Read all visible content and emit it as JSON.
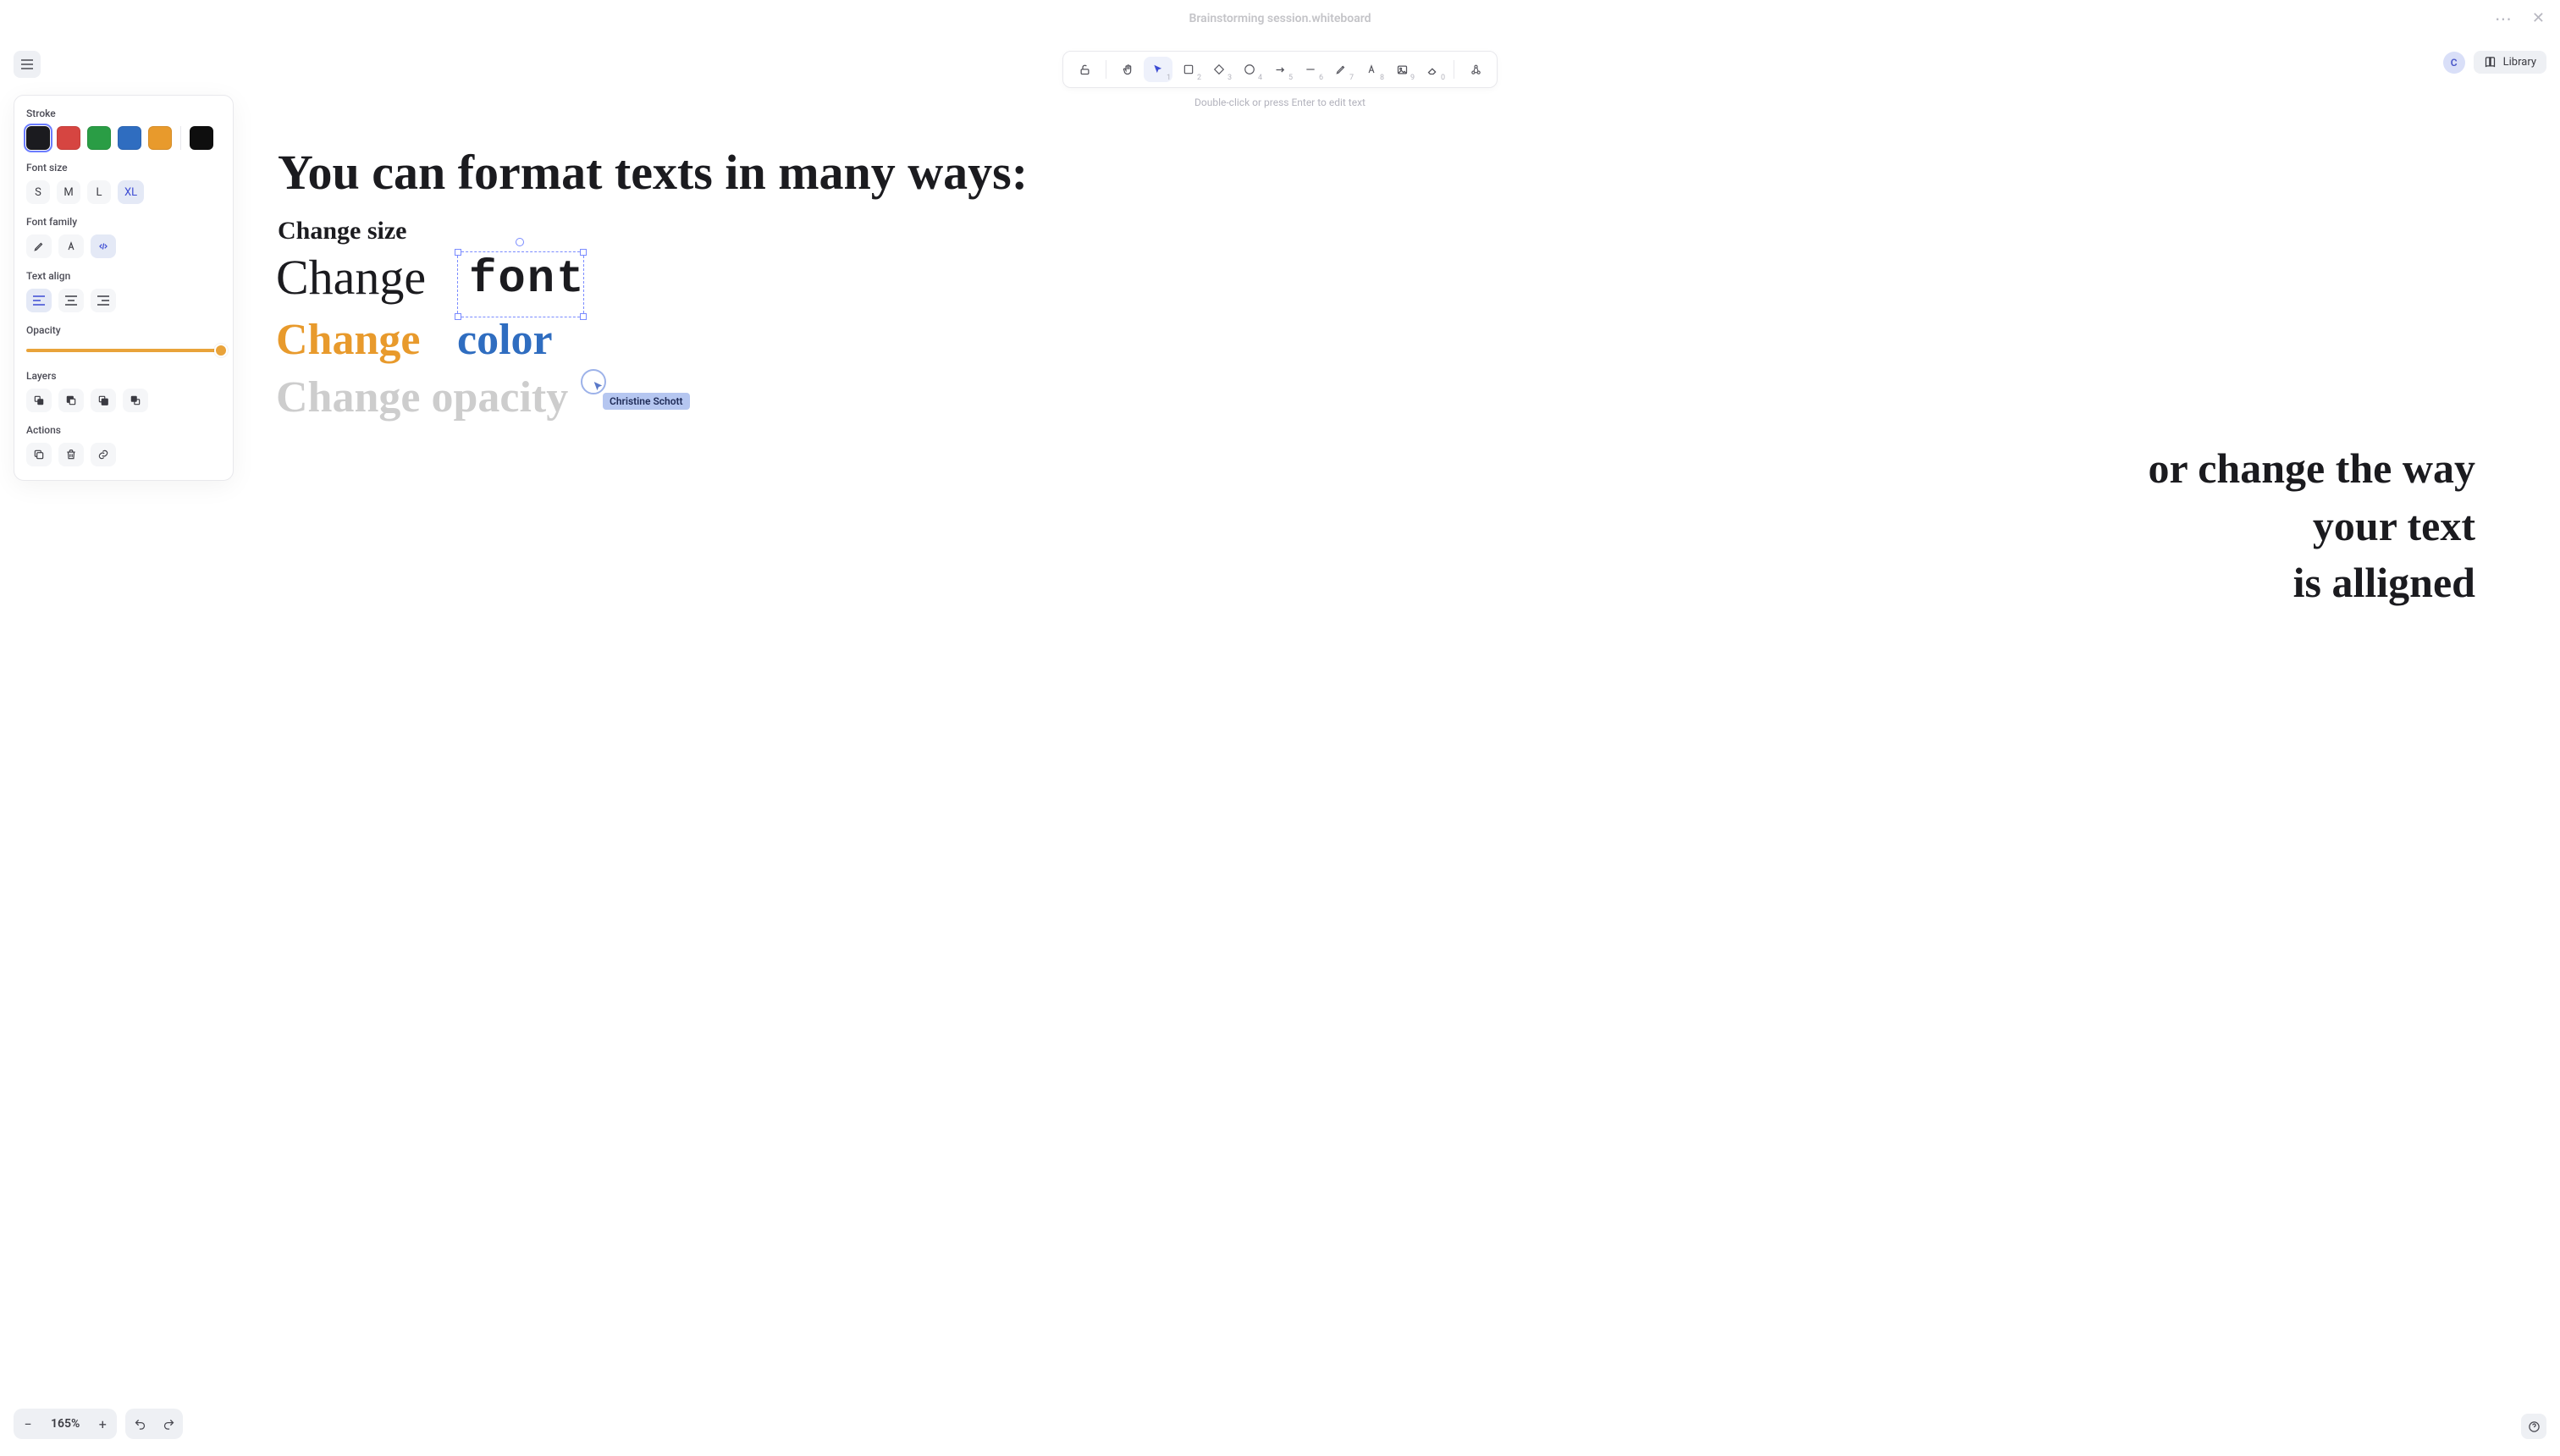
{
  "titlebar": {
    "title": "Brainstorming session.whiteboard"
  },
  "hint": "Double-click or press Enter to edit text",
  "toolbar": {
    "tools": [
      {
        "name": "lock",
        "num": ""
      },
      {
        "name": "hand",
        "num": ""
      },
      {
        "name": "select",
        "num": "1",
        "active": true
      },
      {
        "name": "rectangle",
        "num": "2"
      },
      {
        "name": "diamond",
        "num": "3"
      },
      {
        "name": "ellipse",
        "num": "4"
      },
      {
        "name": "arrow",
        "num": "5"
      },
      {
        "name": "line",
        "num": "6"
      },
      {
        "name": "draw",
        "num": "7"
      },
      {
        "name": "text",
        "num": "8"
      },
      {
        "name": "image",
        "num": "9"
      },
      {
        "name": "eraser",
        "num": "0"
      },
      {
        "name": "shapes-extra",
        "num": ""
      }
    ]
  },
  "topright": {
    "avatar_initial": "C",
    "library_label": "Library"
  },
  "panel": {
    "stroke": {
      "label": "Stroke",
      "colors": [
        "#1b1b1f",
        "#d64541",
        "#2a9d45",
        "#2f6dc0",
        "#e89a2c",
        "#0e0e0e"
      ],
      "selected_index": 0
    },
    "font_size": {
      "label": "Font size",
      "options": [
        "S",
        "M",
        "L",
        "XL"
      ],
      "selected_index": 3
    },
    "font_family": {
      "label": "Font family",
      "options": [
        "hand",
        "normal",
        "code"
      ],
      "selected_index": 2
    },
    "text_align": {
      "label": "Text align",
      "options": [
        "left",
        "center",
        "right"
      ],
      "selected_index": 0
    },
    "opacity": {
      "label": "Opacity",
      "value": 100
    },
    "layers": {
      "label": "Layers",
      "actions": [
        "send-to-back",
        "send-backward",
        "bring-forward",
        "bring-to-front"
      ]
    },
    "actions": {
      "label": "Actions",
      "actions": [
        "duplicate",
        "delete",
        "link"
      ]
    }
  },
  "canvas": {
    "heading": "You can format texts in many ways:",
    "change_size": "Change size",
    "change_font_a": "Change",
    "change_font_b": "font",
    "change_color_a": "Change",
    "change_color_b": "color",
    "change_opacity": "Change opacity",
    "aligned": "or change the way\nyour text\nis alligned"
  },
  "collaborator": {
    "name": "Christine Schott"
  },
  "zoom": {
    "level": "165%"
  }
}
